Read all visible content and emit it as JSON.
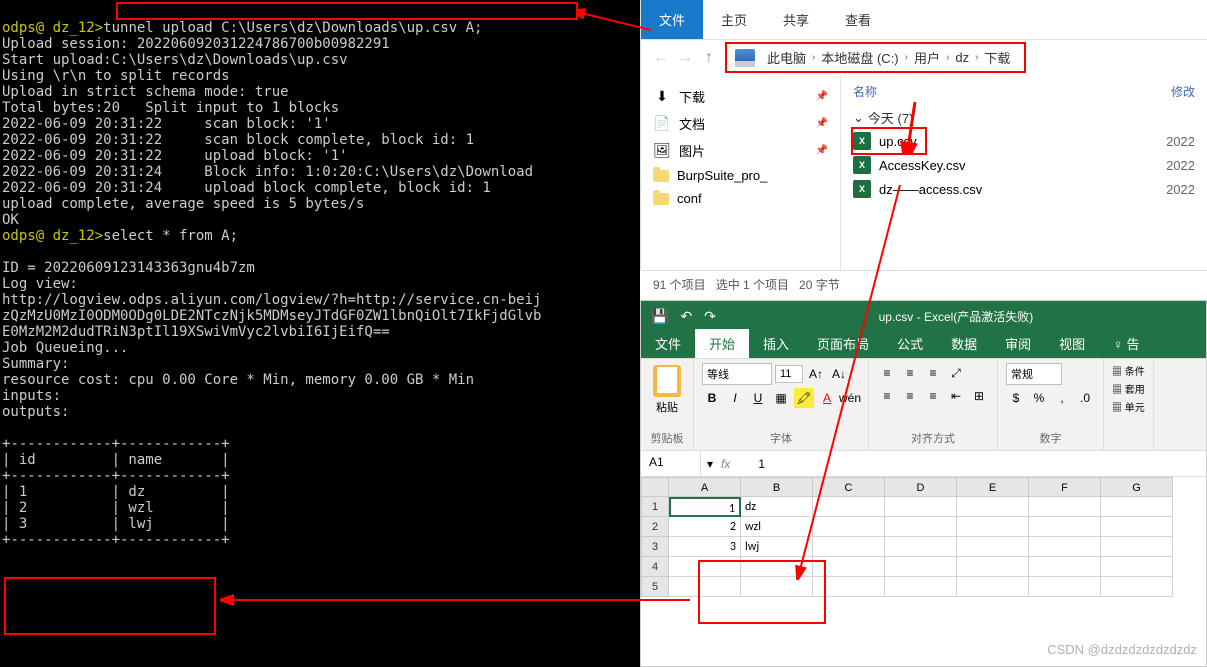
{
  "terminal": {
    "prompt1": "odps@ dz_12>",
    "cmd1": "tunnel upload C:\\Users\\dz\\Downloads\\up.csv A;",
    "line2": "Upload session: 202206092031224786700b00982291",
    "line3": "Start upload:C:\\Users\\dz\\Downloads\\up.csv",
    "line4": "Using \\r\\n to split records",
    "line5": "Upload in strict schema mode: true",
    "line6": "Total bytes:20   Split input to 1 blocks",
    "line7": "2022-06-09 20:31:22     scan block: '1'",
    "line8": "2022-06-09 20:31:22     scan block complete, block id: 1",
    "line9": "2022-06-09 20:31:22     upload block: '1'",
    "line10": "2022-06-09 20:31:24     Block info: 1:0:20:C:\\Users\\dz\\Download",
    "line11": "2022-06-09 20:31:24     upload block complete, block id: 1",
    "line12": "upload complete, average speed is 5 bytes/s",
    "line13": "OK",
    "prompt2": "odps@ dz_12>",
    "cmd2": "select * from A;",
    "line15": "",
    "line16": "ID = 20220609123143363gnu4b7zm",
    "line17": "Log view:",
    "line18": "http://logview.odps.aliyun.com/logview/?h=http://service.cn-beij",
    "line19": "zQzMzU0MzI0ODM0ODg0LDE2NTczNjk5MDMseyJTdGF0ZW1lbnQiOlt7IkFjdGlvb",
    "line20": "E0MzM2M2dudTRiN3ptIl19XSwiVmVyc2lvbiI6IjEifQ==",
    "line21": "Job Queueing...",
    "line22": "Summary:",
    "line23": "resource cost: cpu 0.00 Core * Min, memory 0.00 GB * Min",
    "line24": "inputs:",
    "line25": "outputs:",
    "line26": "",
    "tbl_sep": "+------------+------------+",
    "tbl_hdr": "| id         | name       |",
    "tbl_r1": "| 1          | dz         |",
    "tbl_r2": "| 2          | wzl        |",
    "tbl_r3": "| 3          | lwj        |"
  },
  "explorer": {
    "tabs": {
      "file": "文件",
      "home": "主页",
      "share": "共享",
      "view": "查看"
    },
    "breadcrumb": [
      "此电脑",
      "本地磁盘 (C:)",
      "用户",
      "dz",
      "下载"
    ],
    "sidebar": [
      {
        "label": "下载",
        "icon": "download"
      },
      {
        "label": "文档",
        "icon": "doc"
      },
      {
        "label": "图片",
        "icon": "pic"
      },
      {
        "label": "BurpSuite_pro_",
        "icon": "folder"
      },
      {
        "label": "conf",
        "icon": "folder"
      }
    ],
    "columns": {
      "name": "名称",
      "modified": "修改"
    },
    "group": "今天 (7)",
    "files": [
      {
        "name": "up.csv",
        "date": "2022"
      },
      {
        "name": "AccessKey.csv",
        "date": "2022"
      },
      {
        "name": "dz——access.csv",
        "date": "2022"
      }
    ],
    "status": {
      "count": "91 个项目",
      "sel": "选中 1 个项目",
      "size": "20 字节"
    }
  },
  "excel": {
    "title": "up.csv - Excel(产品激活失败)",
    "tabs": [
      "文件",
      "开始",
      "插入",
      "页面布局",
      "公式",
      "数据",
      "审阅",
      "视图"
    ],
    "tell": "告",
    "ribbon": {
      "paste": "粘贴",
      "clipboard": "剪贴板",
      "font_name": "等线",
      "font_size": "11",
      "font": "字体",
      "align": "对齐方式",
      "number_format": "常规",
      "number": "数字",
      "cond": "条件",
      "table": "套用",
      "cell": "单元"
    },
    "name_box": "A1",
    "fx": "1",
    "cols": [
      "A",
      "B",
      "C",
      "D",
      "E",
      "F",
      "G"
    ],
    "rows": [
      "1",
      "2",
      "3",
      "4",
      "5"
    ],
    "data": [
      [
        "1",
        "dz"
      ],
      [
        "2",
        "wzl"
      ],
      [
        "3",
        "lwj"
      ]
    ]
  },
  "watermark": "CSDN @dzdzdzdzdzdzdz",
  "chart_data": {
    "type": "table",
    "columns": [
      "id",
      "name"
    ],
    "rows": [
      [
        1,
        "dz"
      ],
      [
        2,
        "wzl"
      ],
      [
        3,
        "lwj"
      ]
    ]
  }
}
